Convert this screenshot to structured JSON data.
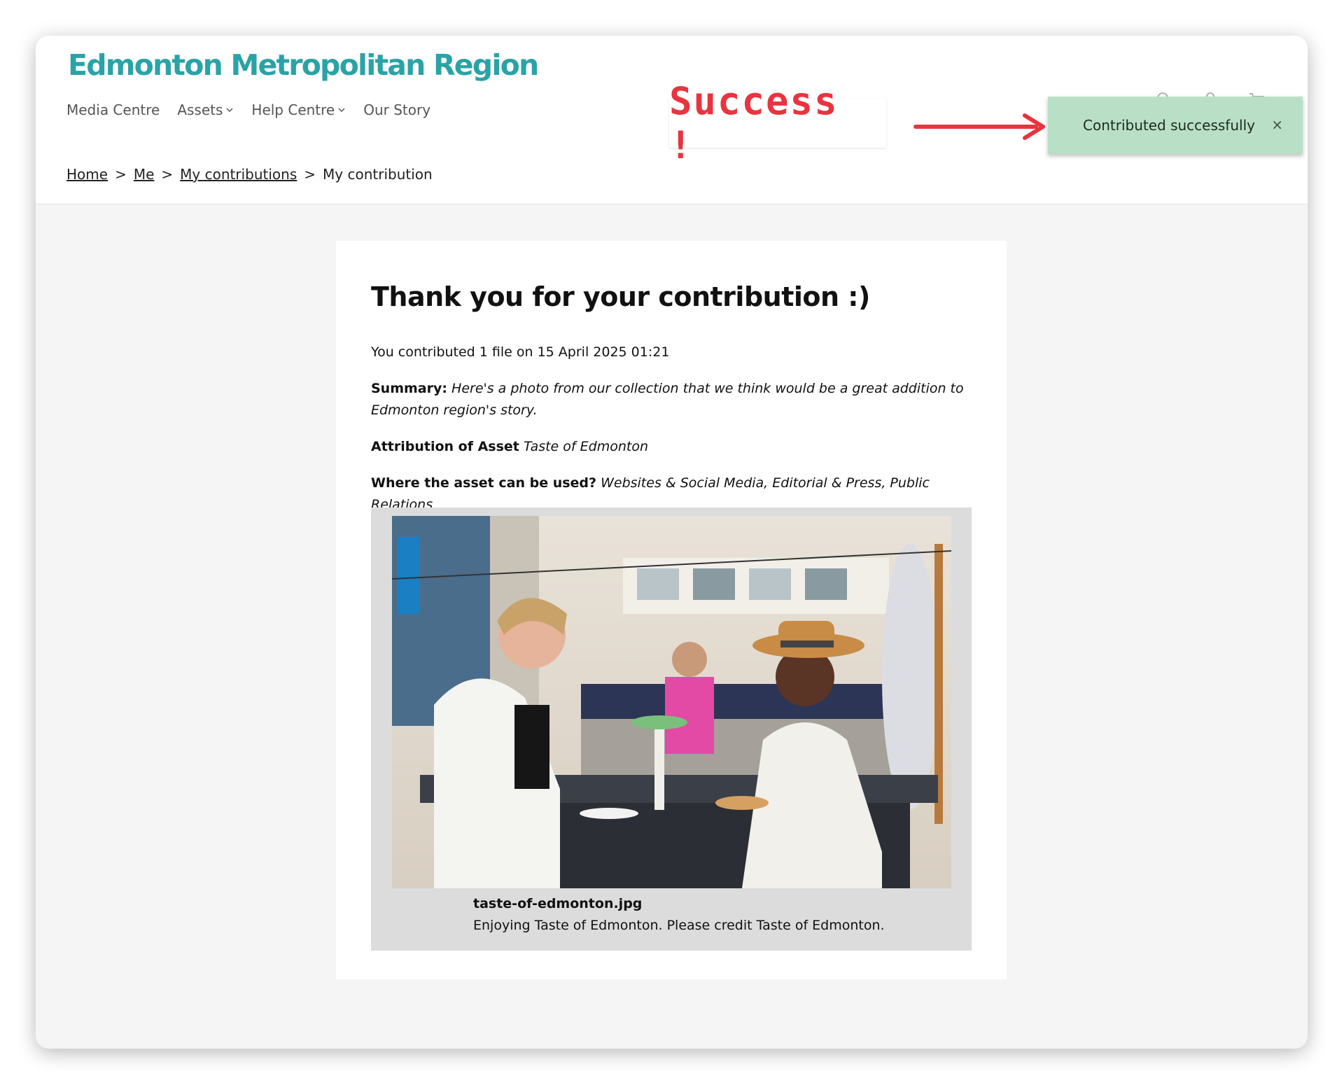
{
  "brand": {
    "name": "Edmonton Metropolitan Region",
    "color": "#2aa3a7"
  },
  "nav": {
    "items": [
      {
        "label": "Media Centre",
        "has_dropdown": false
      },
      {
        "label": "Assets",
        "has_dropdown": true
      },
      {
        "label": "Help Centre",
        "has_dropdown": true
      },
      {
        "label": "Our Story",
        "has_dropdown": false
      }
    ]
  },
  "breadcrumb": {
    "items": [
      {
        "label": "Home",
        "link": true
      },
      {
        "label": "Me",
        "link": true
      },
      {
        "label": "My contributions",
        "link": true
      },
      {
        "label": "My contribution",
        "link": false
      }
    ],
    "separator": ">"
  },
  "annotation": {
    "text": "Success !",
    "color": "#e8343f"
  },
  "toast": {
    "message": "Contributed successfully",
    "close": "×",
    "bg": "#b9e0c6"
  },
  "contribution": {
    "title": "Thank you for your contribution :)",
    "contributed": "You contributed 1 file on 15 April 2025 01:21",
    "summary_label": "Summary:",
    "summary_value": "Here's a photo from our collection that we think would be a great addition to Edmonton region's story.",
    "attribution_label": "Attribution of Asset",
    "attribution_value": "Taste of Edmonton",
    "usage_label": "Where the asset can be used?",
    "usage_value": "Websites & Social Media, Editorial & Press, Public Relations"
  },
  "file": {
    "name": "taste-of-edmonton.jpg",
    "description": "Enjoying Taste of Edmonton. Please credit Taste of Edmonton.",
    "image": "photo of two women laughing at an outdoor table at a festival"
  }
}
